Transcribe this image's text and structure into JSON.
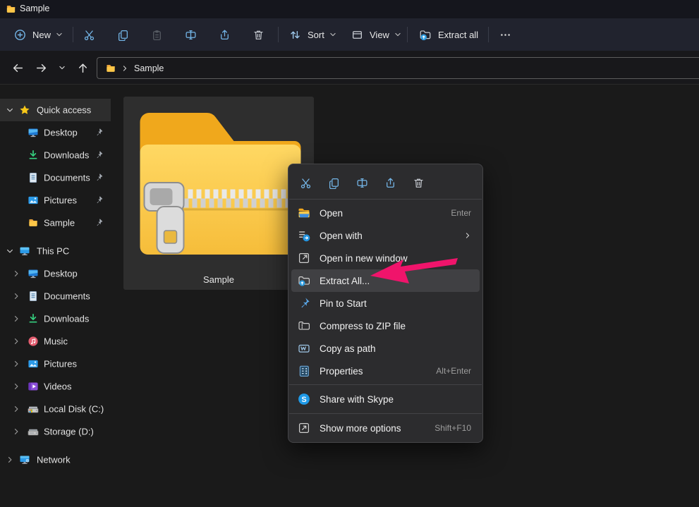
{
  "window": {
    "title": "Sample"
  },
  "toolbar": {
    "new": "New",
    "sort": "Sort",
    "view": "View",
    "extract_all": "Extract all",
    "icon_buttons": [
      {
        "name": "cut",
        "enabled": true
      },
      {
        "name": "copy",
        "enabled": true
      },
      {
        "name": "paste",
        "enabled": false
      },
      {
        "name": "rename",
        "enabled": true
      },
      {
        "name": "share",
        "enabled": true
      },
      {
        "name": "delete",
        "enabled": true
      }
    ]
  },
  "address_bar": {
    "location": "Sample"
  },
  "sidebar": {
    "sections": [
      {
        "id": "quick-access",
        "label": "Quick access",
        "icon": "star",
        "chevron": "down",
        "selected": true,
        "items": [
          {
            "label": "Desktop",
            "icon": "desktop",
            "pinned": true
          },
          {
            "label": "Downloads",
            "icon": "downloads",
            "pinned": true
          },
          {
            "label": "Documents",
            "icon": "documents",
            "pinned": true
          },
          {
            "label": "Pictures",
            "icon": "pictures",
            "pinned": true
          },
          {
            "label": "Sample",
            "icon": "folder",
            "pinned": true
          }
        ]
      },
      {
        "id": "this-pc",
        "label": "This PC",
        "icon": "thispc",
        "chevron": "down",
        "items": [
          {
            "label": "Desktop",
            "icon": "desktop",
            "expandable": true
          },
          {
            "label": "Documents",
            "icon": "documents",
            "expandable": true
          },
          {
            "label": "Downloads",
            "icon": "downloads",
            "expandable": true
          },
          {
            "label": "Music",
            "icon": "music",
            "expandable": true
          },
          {
            "label": "Pictures",
            "icon": "pictures",
            "expandable": true
          },
          {
            "label": "Videos",
            "icon": "videos",
            "expandable": true
          },
          {
            "label": "Local Disk (C:)",
            "icon": "diskc",
            "expandable": true
          },
          {
            "label": "Storage (D:)",
            "icon": "diskd",
            "expandable": true
          }
        ]
      },
      {
        "id": "network",
        "label": "Network",
        "icon": "network",
        "chevron": "right",
        "items": []
      }
    ]
  },
  "main": {
    "selected_file": {
      "name": "Sample",
      "kind": "zipped-folder"
    }
  },
  "context_menu": {
    "quick_actions": [
      "cut",
      "copy",
      "rename",
      "share",
      "delete"
    ],
    "items": [
      {
        "label": "Open",
        "icon": "mopen",
        "shortcut": "Enter"
      },
      {
        "label": "Open with",
        "icon": "mopenwith",
        "submenu": true
      },
      {
        "label": "Open in new window",
        "icon": "mnewwin"
      },
      {
        "label": "Extract All...",
        "icon": "mextract",
        "highlighted": true
      },
      {
        "label": "Pin to Start",
        "icon": "mpin"
      },
      {
        "label": "Compress to ZIP file",
        "icon": "mcompress"
      },
      {
        "label": "Copy as path",
        "icon": "mcopypath"
      },
      {
        "label": "Properties",
        "icon": "mproperties",
        "shortcut": "Alt+Enter"
      },
      {
        "divider": true
      },
      {
        "label": "Share with Skype",
        "icon": "mskype",
        "tall": true
      },
      {
        "divider": true
      },
      {
        "label": "Show more options",
        "icon": "mshowmore",
        "shortcut": "Shift+F10",
        "tall": true
      }
    ]
  },
  "annotation": {
    "arrow_color": "#f0146b",
    "points_to": "Extract All..."
  },
  "colors": {
    "toolbar_bg": "#21232e",
    "menu_bg": "#2c2c2e",
    "highlight": "#404043",
    "tile_bg": "#2e2e2e"
  }
}
